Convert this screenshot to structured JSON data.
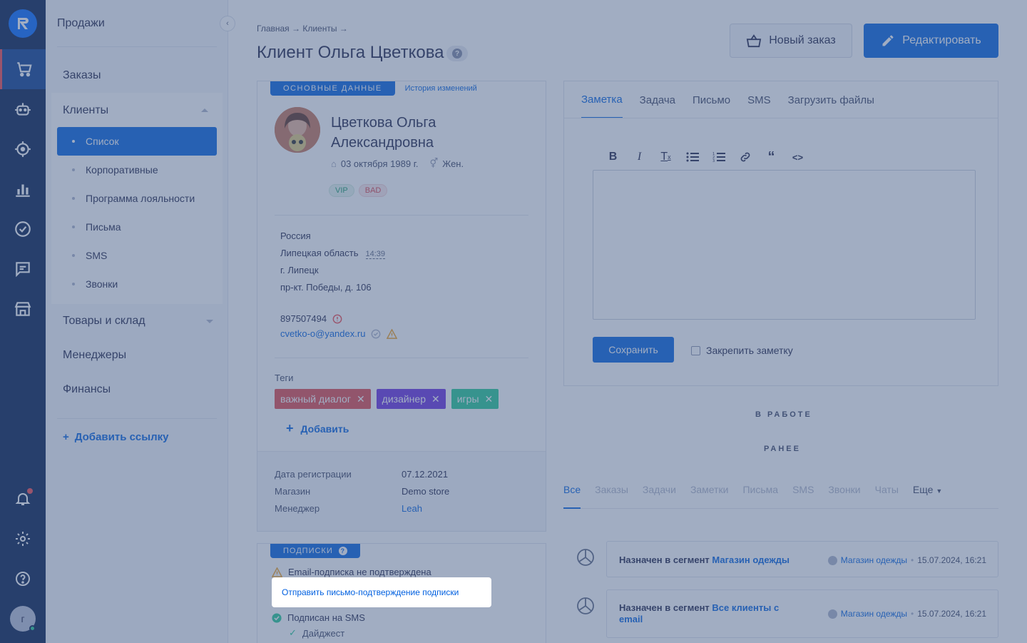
{
  "rail": {
    "items": [
      {
        "icon": "cart-icon",
        "active": true
      },
      {
        "icon": "robot-icon"
      },
      {
        "icon": "target-icon"
      },
      {
        "icon": "analytics-icon"
      },
      {
        "icon": "check-circle-icon"
      },
      {
        "icon": "chat-icon"
      },
      {
        "icon": "store-icon"
      }
    ],
    "bottom": [
      "bell-icon",
      "gear-icon",
      "help-icon"
    ],
    "avatar_letter": "г"
  },
  "sidebar": {
    "section_title": "Продажи",
    "orders": "Заказы",
    "clients": "Клиенты",
    "clients_sub": [
      "Список",
      "Корпоративные",
      "Программа лояльности",
      "Письма",
      "SMS",
      "Звонки"
    ],
    "goods": "Товары и склад",
    "managers": "Менеджеры",
    "finance": "Финансы",
    "add_link": "Добавить ссылку"
  },
  "header": {
    "breadcrumb": "Главная → Клиенты →",
    "title": "Клиент Ольга Цветкова",
    "btn_new_order": "Новый заказ",
    "btn_edit": "Редактировать"
  },
  "client": {
    "tab_main": "ОСНОВНЫЕ ДАННЫЕ",
    "tab_history": "История изменений",
    "name": "Цветкова Ольга Александровна",
    "birthday": "03 октября 1989 г.",
    "gender": "Жен.",
    "chips": [
      "VIP",
      "BAD"
    ],
    "country": "Россия",
    "region": "Липецкая область",
    "local_time": "14:39",
    "city": "г. Липецк",
    "street": "пр-кт. Победы, д. 106",
    "phone": "897507494",
    "email": "cvetko-o@yandex.ru",
    "tags_label": "Теги",
    "tags": [
      {
        "label": "важный диалог",
        "color": "#e0474c"
      },
      {
        "label": "дизайнер",
        "color": "#6a2fe0"
      },
      {
        "label": "игры",
        "color": "#22c993"
      }
    ],
    "add_tag": "Добавить",
    "reg_label": "Дата регистрации",
    "reg_value": "07.12.2021",
    "shop_label": "Магазин",
    "shop_value": "Demo store",
    "manager_label": "Менеджер",
    "manager_value": "Leah"
  },
  "subscriptions": {
    "tab": "ПОДПИСКИ",
    "email_warning": "Email-подписка не подтверждена",
    "send_confirm": "Отправить письмо-подтверждение подписки",
    "sms": "Подписан на SMS",
    "digest": "Дайджест"
  },
  "editor": {
    "tabs": [
      "Заметка",
      "Задача",
      "Письмо",
      "SMS",
      "Загрузить файлы"
    ],
    "toolbar": [
      "B",
      "I",
      "T",
      "ul",
      "ol",
      "link",
      "quote",
      "code"
    ],
    "save": "Сохранить",
    "pin": "Закрепить заметку"
  },
  "feed": {
    "in_work": "В РАБОТЕ",
    "earlier": "РАНЕЕ",
    "tabs": [
      "Все",
      "Заказы",
      "Задачи",
      "Заметки",
      "Письма",
      "SMS",
      "Звонки",
      "Чаты",
      "Еще"
    ],
    "items": [
      {
        "prefix": "Назначен в сегмент",
        "segment": "Магазин одежды",
        "shop": "Магазин одежды",
        "date": "15.07.2024, 16:21"
      },
      {
        "prefix": "Назначен в сегмент",
        "segment": "Все клиенты с email",
        "shop": "Магазин одежды",
        "date": "15.07.2024, 16:21"
      }
    ]
  },
  "colors": {
    "rail": "#001a4d",
    "accent": "#0060e0",
    "overlay": "#4a618a"
  }
}
